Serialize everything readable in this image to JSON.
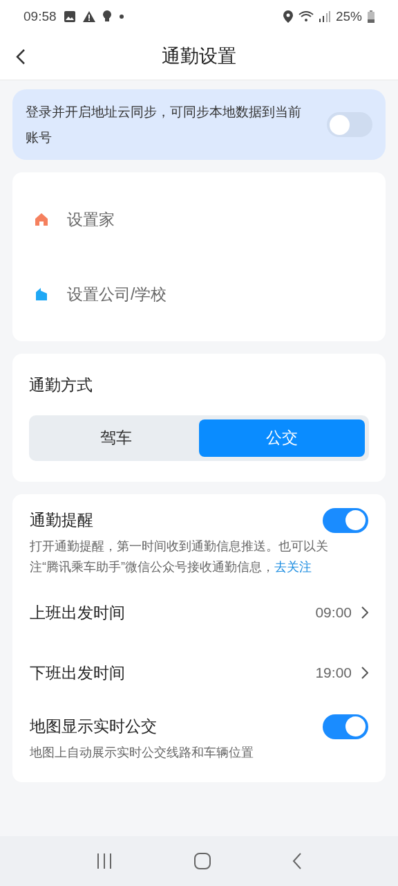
{
  "status_bar": {
    "time": "09:58",
    "battery": "25%"
  },
  "header": {
    "title": "通勤设置"
  },
  "sync_banner": {
    "text": "登录并开启地址云同步，可同步本地数据到当前账号",
    "on": false
  },
  "addresses": [
    {
      "kind": "home",
      "label": "设置家"
    },
    {
      "kind": "work",
      "label": "设置公司/学校"
    }
  ],
  "commute_mode": {
    "title": "通勤方式",
    "options": [
      {
        "label": "驾车",
        "selected": false
      },
      {
        "label": "公交",
        "selected": true
      }
    ]
  },
  "settings": [
    {
      "kind": "toggle",
      "label": "通勤提醒",
      "on": true,
      "description": "打开通勤提醒，第一时间收到通勤信息推送。也可以关注“腾讯乘车助手”微信公众号接收通勤信息，",
      "link": "去关注"
    },
    {
      "kind": "value",
      "label": "上班出发时间",
      "value": "09:00"
    },
    {
      "kind": "value",
      "label": "下班出发时间",
      "value": "19:00"
    },
    {
      "kind": "toggle",
      "label": "地图显示实时公交",
      "on": true,
      "description": "地图上自动展示实时公交线路和车辆位置"
    }
  ]
}
